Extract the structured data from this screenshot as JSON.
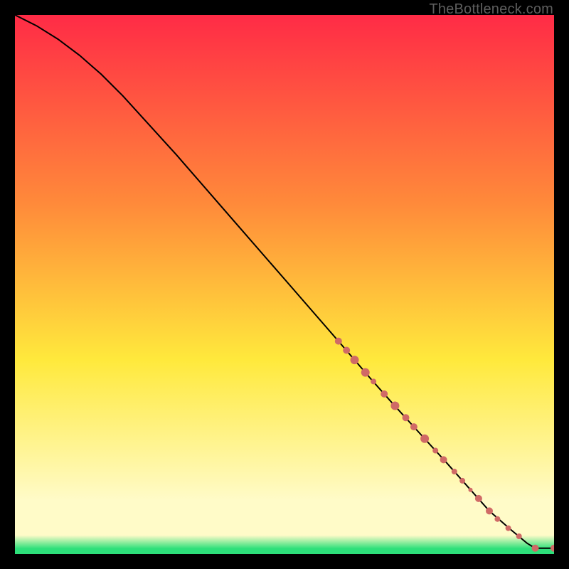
{
  "watermark": "TheBottleneck.com",
  "palette": {
    "red": "#ff2b46",
    "orange": "#ff8a3a",
    "yellow": "#ffe93c",
    "lightyellow": "#fffbc8",
    "green": "#2de07a",
    "black": "#000000",
    "marker": "#d06a66",
    "curve": "#000000"
  },
  "chart_data": {
    "type": "line",
    "title": "",
    "xlabel": "",
    "ylabel": "",
    "xlim": [
      0,
      100
    ],
    "ylim": [
      0,
      100
    ],
    "curve": {
      "x": [
        0,
        4,
        8,
        12,
        16,
        20,
        30,
        40,
        50,
        60,
        66,
        70,
        75,
        80,
        84,
        88,
        92,
        95,
        96.5,
        100
      ],
      "y": [
        100,
        98,
        95.5,
        92.5,
        89,
        85,
        74,
        62.5,
        51,
        39.5,
        32.5,
        28,
        22.5,
        17,
        12.5,
        8,
        4.5,
        2,
        1.1,
        1.1
      ]
    },
    "markers": [
      {
        "x": 60.0,
        "y": 39.5,
        "r": 5
      },
      {
        "x": 61.5,
        "y": 37.8,
        "r": 5
      },
      {
        "x": 63.0,
        "y": 36.0,
        "r": 6
      },
      {
        "x": 65.0,
        "y": 33.7,
        "r": 6
      },
      {
        "x": 66.5,
        "y": 32.0,
        "r": 4
      },
      {
        "x": 68.5,
        "y": 29.7,
        "r": 5
      },
      {
        "x": 70.5,
        "y": 27.5,
        "r": 6
      },
      {
        "x": 72.5,
        "y": 25.3,
        "r": 5
      },
      {
        "x": 74.0,
        "y": 23.6,
        "r": 5
      },
      {
        "x": 76.0,
        "y": 21.4,
        "r": 6
      },
      {
        "x": 78.0,
        "y": 19.2,
        "r": 4
      },
      {
        "x": 79.5,
        "y": 17.5,
        "r": 5
      },
      {
        "x": 81.5,
        "y": 15.3,
        "r": 4
      },
      {
        "x": 83.0,
        "y": 13.6,
        "r": 4
      },
      {
        "x": 84.5,
        "y": 11.9,
        "r": 3
      },
      {
        "x": 86.0,
        "y": 10.3,
        "r": 5
      },
      {
        "x": 88.0,
        "y": 8.0,
        "r": 5
      },
      {
        "x": 89.5,
        "y": 6.5,
        "r": 4
      },
      {
        "x": 91.5,
        "y": 4.8,
        "r": 4
      },
      {
        "x": 93.5,
        "y": 3.3,
        "r": 4
      },
      {
        "x": 96.5,
        "y": 1.1,
        "r": 5
      },
      {
        "x": 100.0,
        "y": 1.1,
        "r": 5
      }
    ]
  }
}
